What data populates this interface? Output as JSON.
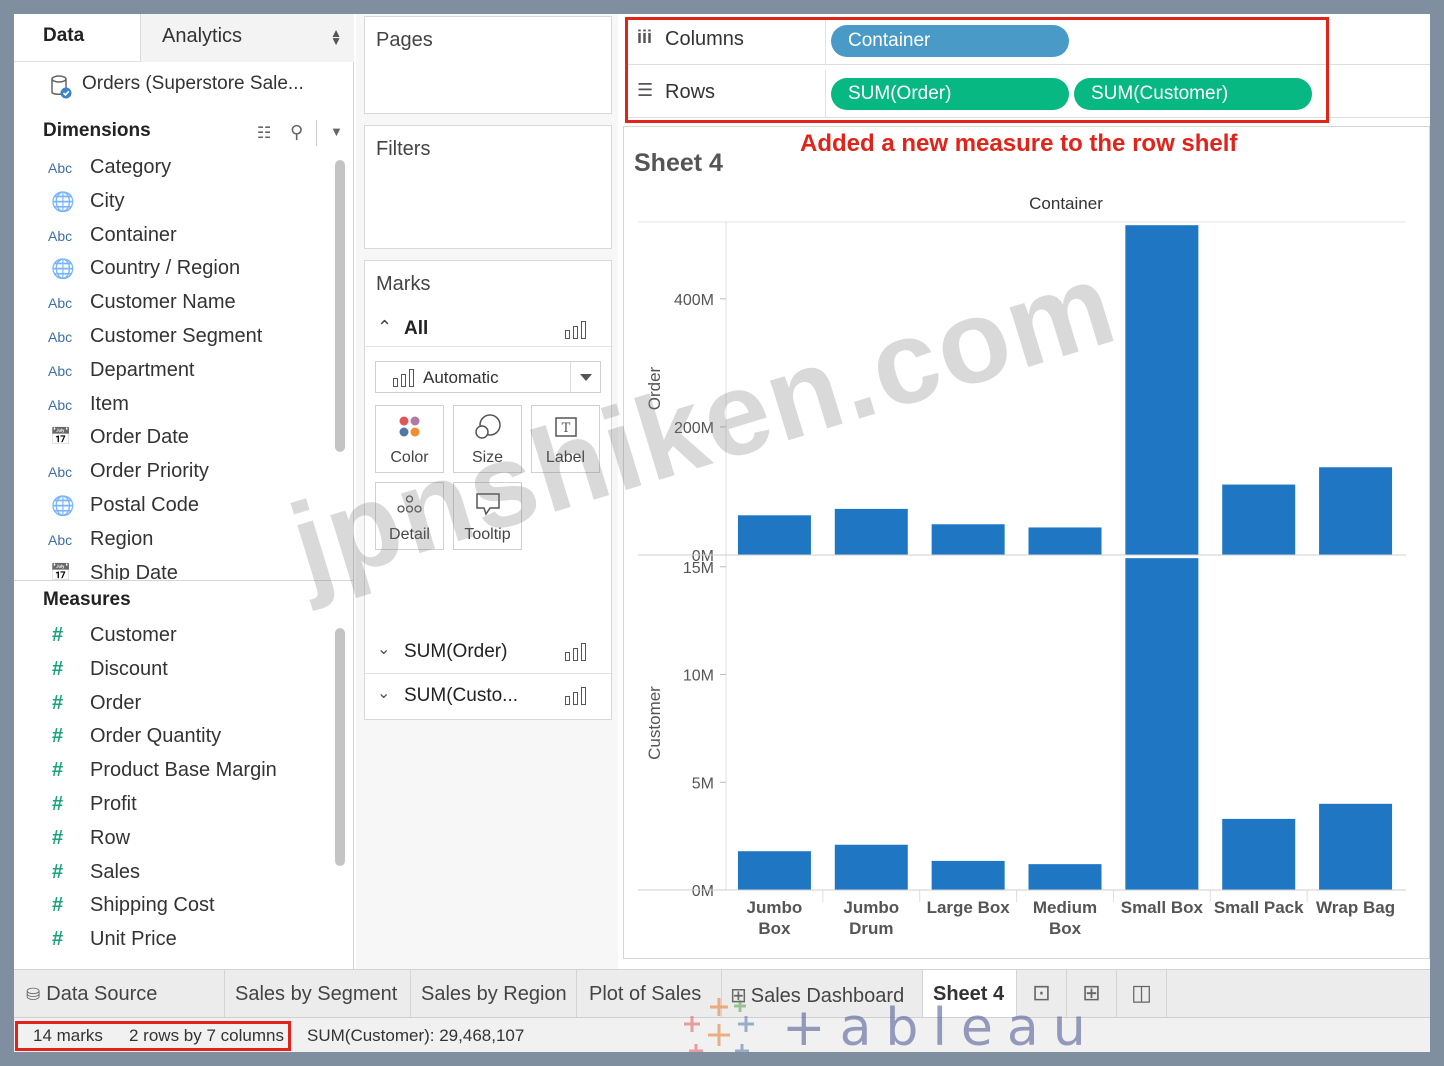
{
  "data_pane": {
    "tab_data": "Data",
    "tab_analytics": "Analytics",
    "datasource_name": "Orders (Superstore Sale...",
    "dimensions_header": "Dimensions",
    "measures_header": "Measures",
    "dimensions": [
      {
        "label": "Category",
        "icon": "Abc"
      },
      {
        "label": "City",
        "icon": "globe"
      },
      {
        "label": "Container",
        "icon": "Abc"
      },
      {
        "label": "Country / Region",
        "icon": "globe"
      },
      {
        "label": "Customer Name",
        "icon": "Abc"
      },
      {
        "label": "Customer Segment",
        "icon": "Abc"
      },
      {
        "label": "Department",
        "icon": "Abc"
      },
      {
        "label": "Item",
        "icon": "Abc"
      },
      {
        "label": "Order Date",
        "icon": "calendar"
      },
      {
        "label": "Order Priority",
        "icon": "Abc"
      },
      {
        "label": "Postal Code",
        "icon": "globe"
      },
      {
        "label": "Region",
        "icon": "Abc"
      },
      {
        "label": "Ship Date",
        "icon": "calendar"
      }
    ],
    "measures": [
      {
        "label": "Customer"
      },
      {
        "label": "Discount"
      },
      {
        "label": "Order"
      },
      {
        "label": "Order Quantity"
      },
      {
        "label": "Product Base Margin"
      },
      {
        "label": "Profit"
      },
      {
        "label": "Row"
      },
      {
        "label": "Sales"
      },
      {
        "label": "Shipping Cost"
      },
      {
        "label": "Unit Price"
      }
    ],
    "abc_label": "Abc"
  },
  "cards": {
    "pages": "Pages",
    "filters": "Filters",
    "marks": "Marks",
    "marks_all": "All",
    "mark_type": "Automatic",
    "buttons": {
      "color": "Color",
      "size": "Size",
      "label": "Label",
      "detail": "Detail",
      "tooltip": "Tooltip"
    },
    "measure_pills": [
      "SUM(Order)",
      "SUM(Custo..."
    ]
  },
  "shelves": {
    "columns_label": "Columns",
    "rows_label": "Rows",
    "columns_pills": [
      "Container"
    ],
    "rows_pills": [
      "SUM(Order)",
      "SUM(Customer)"
    ]
  },
  "annotation": "Added a new measure to the row shelf",
  "sheet_title": "Sheet 4",
  "tabs": {
    "data_source": "Data Source",
    "sheets": [
      "Sales by Segment",
      "Sales by Region",
      "Plot of Sales",
      "Sales Dashboard",
      "Sheet 4"
    ]
  },
  "status": {
    "marks": "14 marks",
    "dims": "2 rows by 7 columns",
    "sum": "SUM(Customer): 29,468,107"
  },
  "watermark": "jpnshiken.com",
  "logo_word": "+ableau",
  "colors": {
    "bar": "#1f77c4",
    "highlight": "#e2231a",
    "dim_pill": "#4a9ac7",
    "measure_pill": "#08b882"
  },
  "chart_data": {
    "type": "bar",
    "title": "Container",
    "categories": [
      "Jumbo Box",
      "Jumbo Drum",
      "Large Box",
      "Medium Box",
      "Small Box",
      "Small Pack",
      "Wrap Bag"
    ],
    "category_lines": [
      [
        "Jumbo",
        "Box"
      ],
      [
        "Jumbo",
        "Drum"
      ],
      [
        "Large Box"
      ],
      [
        "Medium",
        "Box"
      ],
      [
        "Small Box"
      ],
      [
        "Small Pack"
      ],
      [
        "Wrap Bag"
      ]
    ],
    "panes": [
      {
        "measure": "Order",
        "ylabel": "Order",
        "ylim": [
          0,
          520000000
        ],
        "ticks": [
          {
            "v": 0,
            "label": "0M"
          },
          {
            "v": 200000000,
            "label": "200M"
          },
          {
            "v": 400000000,
            "label": "400M"
          }
        ],
        "values": [
          62000000,
          72000000,
          48000000,
          43000000,
          515000000,
          110000000,
          137000000
        ]
      },
      {
        "measure": "Customer",
        "ylabel": "Customer",
        "ylim": [
          0,
          15500000
        ],
        "ticks": [
          {
            "v": 0,
            "label": "0M"
          },
          {
            "v": 5000000,
            "label": "5M"
          },
          {
            "v": 10000000,
            "label": "10M"
          },
          {
            "v": 15000000,
            "label": "15M"
          }
        ],
        "values": [
          1800000,
          2100000,
          1350000,
          1200000,
          15400000,
          3300000,
          4000000
        ]
      }
    ]
  }
}
